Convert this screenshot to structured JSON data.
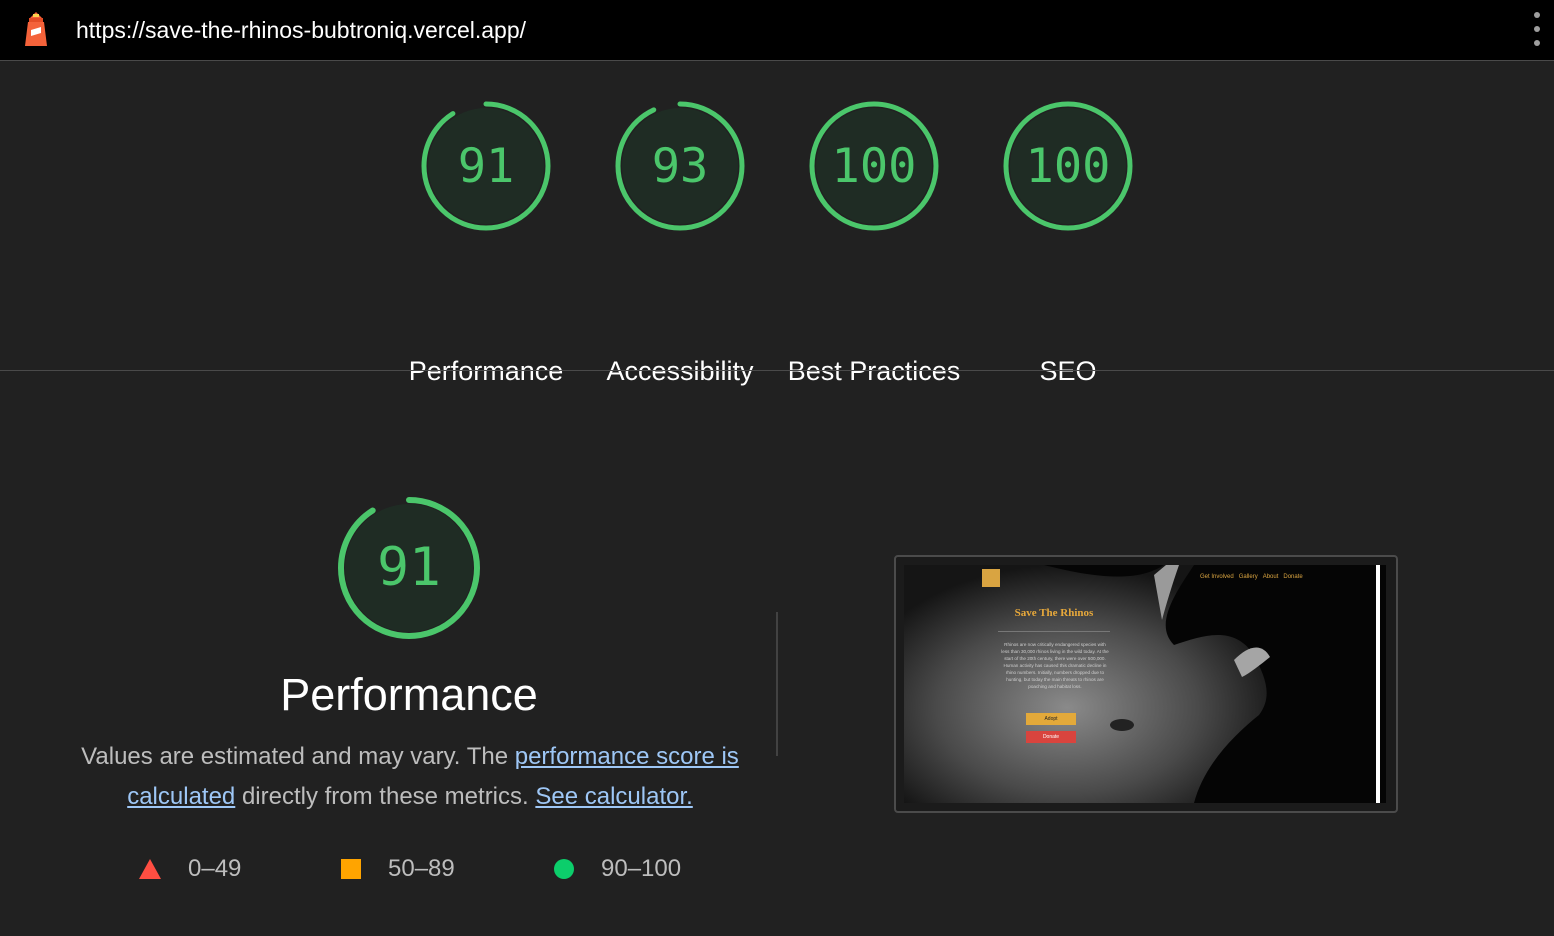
{
  "header": {
    "url": "https://save-the-rhinos-bubtroniq.vercel.app/",
    "logo_icon": "lighthouse-icon",
    "menu_icon": "more-vert-icon"
  },
  "colors": {
    "pass": "#0cce6b",
    "pass_text": "#4bc66b",
    "average": "#ffa400",
    "fail": "#ff4e42",
    "link": "#9ec7f6"
  },
  "categories": [
    {
      "label": "Performance",
      "score": 91
    },
    {
      "label": "Accessibility",
      "score": 93
    },
    {
      "label": "Best Practices",
      "score": 100
    },
    {
      "label": "SEO",
      "score": 100
    }
  ],
  "performance": {
    "score": 91,
    "title": "Performance",
    "desc_prefix": "Values are estimated and may vary. The ",
    "link1": "performance score is calculated",
    "desc_middle": " directly from these metrics. ",
    "link2": "See calculator."
  },
  "legend": [
    {
      "range": "0–49",
      "shape": "triangle",
      "color": "#ff4e42"
    },
    {
      "range": "50–89",
      "shape": "square",
      "color": "#ffa400"
    },
    {
      "range": "90–100",
      "shape": "circle",
      "color": "#0cce6b"
    }
  ],
  "screenshot": {
    "nav": [
      "Get Involved",
      "Gallery",
      "About",
      "Donate"
    ],
    "title": "Save The Rhinos",
    "body": "Rhinos are now critically endangered species with less than 30,000 rhinos living in the wild today. At the start of the 20th century, there were over 500,000. Human activity has caused this dramatic decline in rhino numbers. Initially, numbers dropped due to hunting, but today the main threats to rhinos are poaching and habitat loss.",
    "adopt": "Adopt",
    "donate": "Donate"
  }
}
